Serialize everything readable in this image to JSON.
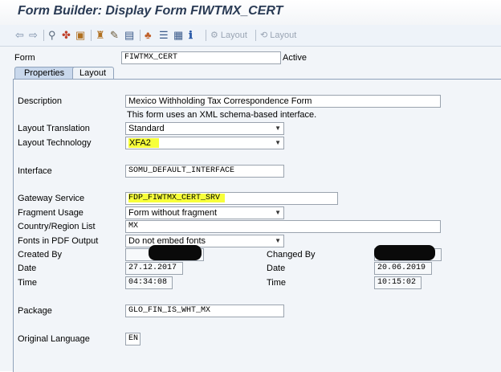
{
  "window": {
    "title": "Form Builder: Display Form FIWTMX_CERT"
  },
  "toolbar": {
    "icons": [
      "back-arrow-icon",
      "forward-arrow-icon",
      "glasses-icon",
      "objects-icon",
      "clipboard-icon",
      "hierarchy-icon",
      "pencil-icon",
      "check-icon",
      "tree-icon",
      "layers-icon",
      "table-icon",
      "info-icon"
    ],
    "layout_label_1": "Layout",
    "layout_label_2": "Layout"
  },
  "form": {
    "label": "Form",
    "value": "FIWTMX_CERT",
    "status": "Active"
  },
  "tabs": [
    {
      "label": "Properties",
      "active": true
    },
    {
      "label": "Layout",
      "active": false
    }
  ],
  "properties": {
    "description_label": "Description",
    "description_value": "Mexico Withholding Tax Correspondence Form",
    "schema_note": "This form uses an XML schema-based interface.",
    "layout_translation_label": "Layout Translation",
    "layout_translation_value": "Standard",
    "layout_technology_label": "Layout Technology",
    "layout_technology_value": "XFA2",
    "interface_label": "Interface",
    "interface_value": "SOMU_DEFAULT_INTERFACE",
    "gateway_label": "Gateway Service",
    "gateway_value": "FDP_FIWTMX_CERT_SRV",
    "fragment_label": "Fragment Usage",
    "fragment_value": "Form without fragment",
    "country_label": "Country/Region List",
    "country_value": "MX",
    "fonts_label": "Fonts in PDF Output",
    "fonts_value": "Do not embed fonts",
    "created_by_label": "Created By",
    "changed_by_label": "Changed By",
    "date_label": "Date",
    "created_date": "27.12.2017",
    "changed_date_label": "Date",
    "changed_date": "20.06.2019",
    "time_label": "Time",
    "created_time": "04:34:08",
    "changed_time_label": "Time",
    "changed_time": "10:15:02",
    "package_label": "Package",
    "package_value": "GLO_FIN_IS_WHT_MX",
    "language_label": "Original Language",
    "language_value": "EN"
  },
  "colors": {
    "highlight": "#f7ff3a",
    "title": "#2a3b55",
    "tab_active": "#c9d8ec"
  }
}
